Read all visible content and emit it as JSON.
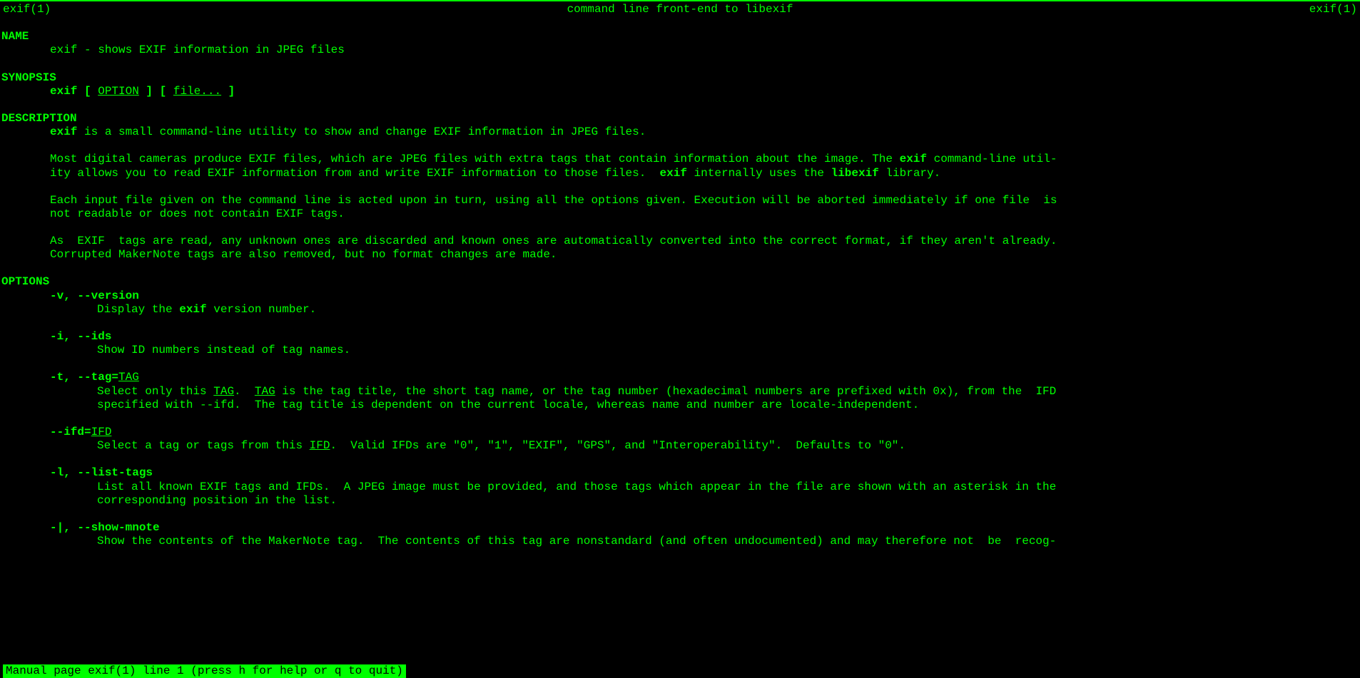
{
  "header": {
    "left": "exif(1)",
    "center": "command line front-end to libexif",
    "right": "exif(1)"
  },
  "sections": {
    "name": {
      "title": "NAME",
      "text": "exif - shows EXIF information in JPEG files"
    },
    "synopsis": {
      "title": "SYNOPSIS",
      "cmd": "exif",
      "open1": " [ ",
      "opt": "OPTION",
      "close1": " ] [ ",
      "file": "file...",
      "close2": " ]"
    },
    "description": {
      "title": "DESCRIPTION",
      "p1a": "exif",
      "p1b": " is a small command-line utility to show and change EXIF information in JPEG files.",
      "p2a": "Most digital cameras produce EXIF files, which are JPEG files with extra tags that contain information about the image. The ",
      "p2b": "exif",
      "p2c": " command-line util-",
      "p2d": "ity allows you to read EXIF information from and write EXIF information to those files.  ",
      "p2e": "exif",
      "p2f": " internally uses the ",
      "p2g": "libexif",
      "p2h": " library.",
      "p3a": "Each input file given on the command line is acted upon in turn, using all the options given. Execution will be aborted immediately if one file  is",
      "p3b": "not readable or does not contain EXIF tags.",
      "p4a": "As  EXIF  tags are read, any unknown ones are discarded and known ones are automatically converted into the correct format, if they aren't already.",
      "p4b": "Corrupted MakerNote tags are also removed, but no format changes are made."
    },
    "options": {
      "title": "OPTIONS",
      "o1": {
        "flag": "-v, --version",
        "d1a": "Display the ",
        "d1b": "exif",
        "d1c": " version number."
      },
      "o2": {
        "flag": "-i, --ids",
        "d": "Show ID numbers instead of tag names."
      },
      "o3": {
        "flaga": "-t, --tag=",
        "flagb": "TAG",
        "d1a": "Select only this ",
        "d1b": "TAG",
        "d1c": ".  ",
        "d1d": "TAG",
        "d1e": " is the tag title, the short tag name, or the tag number (hexadecimal numbers are prefixed with 0x), from the  IFD",
        "d2": "specified with --ifd.  The tag title is dependent on the current locale, whereas name and number are locale-independent."
      },
      "o4": {
        "flaga": "--ifd=",
        "flagb": "IFD",
        "d1a": "Select a tag or tags from this ",
        "d1b": "IFD",
        "d1c": ".  Valid IFDs are \"0\", \"1\", \"EXIF\", \"GPS\", and \"Interoperability\".  Defaults to \"0\"."
      },
      "o5": {
        "flag": "-l, --list-tags",
        "d1": "List all known EXIF tags and IFDs.  A JPEG image must be provided, and those tags which appear in the file are shown with an asterisk in the",
        "d2": "corresponding position in the list."
      },
      "o6": {
        "flag": "-|, --show-mnote",
        "d1": "Show the contents of the MakerNote tag.  The contents of this tag are nonstandard (and often undocumented) and may therefore not  be  recog-"
      }
    }
  },
  "status": " Manual page exif(1) line 1 (press h for help or q to quit)"
}
